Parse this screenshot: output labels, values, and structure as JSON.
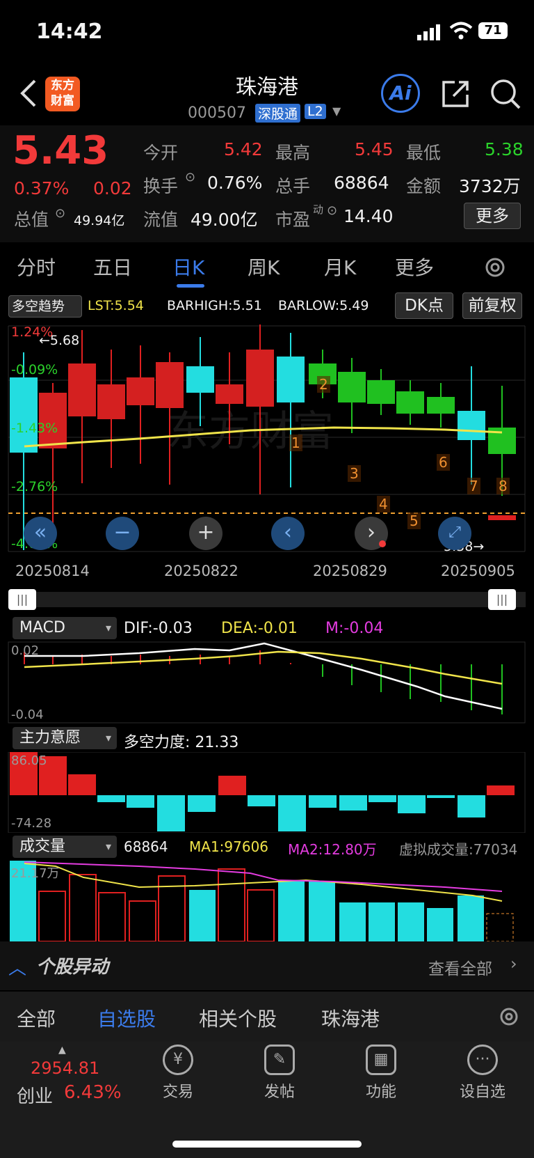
{
  "status": {
    "time": "14:42",
    "battery": "71"
  },
  "header": {
    "title": "珠海港",
    "code": "000507",
    "badge": "深股通",
    "level": "L2",
    "logo_line1": "东方",
    "logo_line2": "财富",
    "ai_label": "Ai"
  },
  "quote": {
    "price": "5.43",
    "pct": "0.37%",
    "chg": "0.02",
    "open_label": "今开",
    "open": "5.42",
    "high_label": "最高",
    "high": "5.45",
    "low_label": "最低",
    "low": "5.38",
    "turnover_label": "换手",
    "turnover": "0.76%",
    "volume_label": "总手",
    "volume": "68864",
    "amount_label": "金额",
    "amount": "3732万",
    "mktcap_label": "总值",
    "mktcap": "49.94亿",
    "float_label": "流值",
    "float": "49.00亿",
    "pe_label": "市盈",
    "pe_sup": "动",
    "pe": "14.40",
    "more": "更多"
  },
  "tabs": [
    "分时",
    "五日",
    "日K",
    "周K",
    "月K",
    "更多"
  ],
  "indicator_bar": {
    "selector": "多空趋势",
    "lst": "LST:5.54",
    "barhigh": "BARHIGH:5.51",
    "barlow": "BARLOW:5.49",
    "dk": "DK点",
    "adj": "前复权"
  },
  "kchart": {
    "pct_labels": [
      "1.24%",
      "-0.09%",
      "-1.43%",
      "-2.76%",
      "-4.09%"
    ],
    "high_mark": "5.68",
    "low_mark": "5.38",
    "dates": [
      "20250814",
      "20250822",
      "20250829",
      "20250905"
    ],
    "signals": [
      "1",
      "2",
      "3",
      "4",
      "5",
      "6",
      "7",
      "8"
    ]
  },
  "macd": {
    "selector": "MACD",
    "dif": "DIF:-0.03",
    "dea": "DEA:-0.01",
    "m": "M:-0.04",
    "top": "0.02",
    "bottom": "-0.04"
  },
  "zhuli": {
    "selector": "主力意愿",
    "label": "多空力度: 21.33",
    "top": "86.05",
    "bottom": "-74.28"
  },
  "vol": {
    "selector": "成交量",
    "v": "68864",
    "ma1": "MA1:97606",
    "ma2": "MA2:12.80万",
    "virtual": "虚拟成交量:77034",
    "top": "21.17万"
  },
  "news": {
    "title": "个股异动",
    "all": "查看全部"
  },
  "bottom_tabs": [
    "全部",
    "自选股",
    "相关个股",
    "珠海港"
  ],
  "index": {
    "value": "2954.81",
    "name": "创业",
    "pct": "6.43%"
  },
  "nav": [
    {
      "label": "交易",
      "icon": "yen-icon"
    },
    {
      "label": "发帖",
      "icon": "edit-icon"
    },
    {
      "label": "功能",
      "icon": "grid-icon"
    },
    {
      "label": "设自选",
      "icon": "dots-icon"
    }
  ]
}
